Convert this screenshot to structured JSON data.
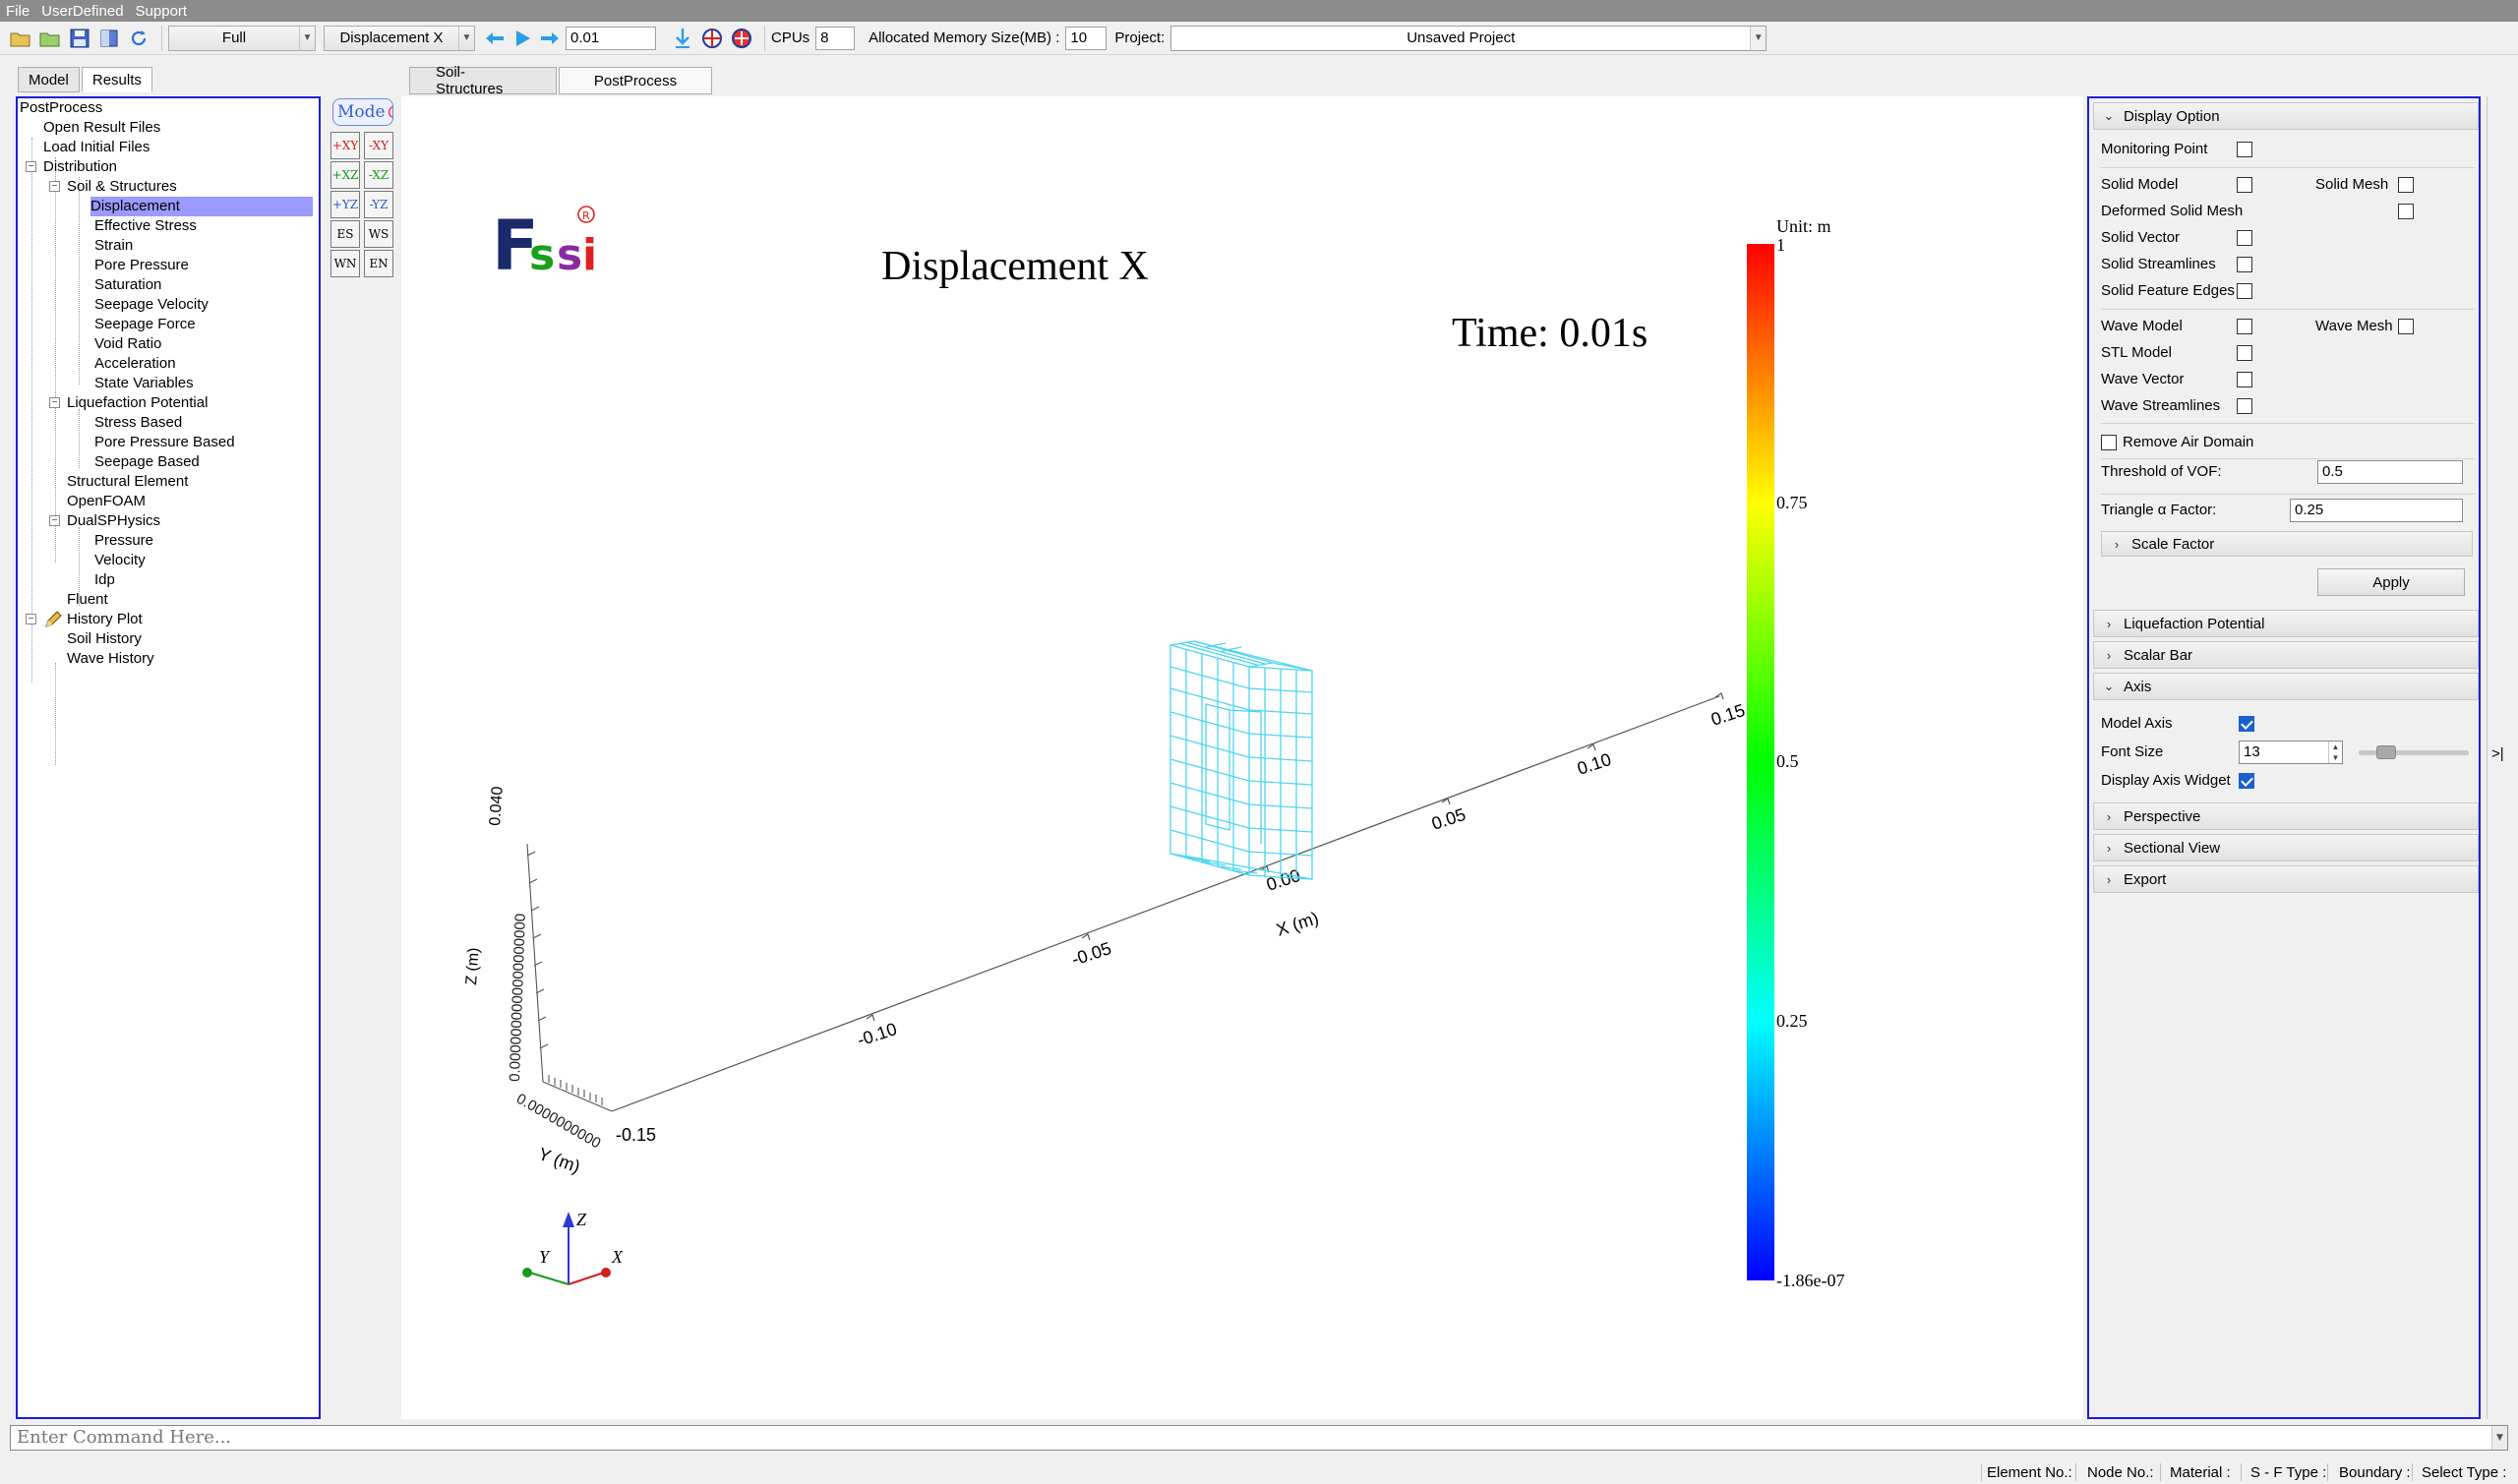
{
  "menu": [
    "File",
    "UserDefined",
    "Support"
  ],
  "toolbar": {
    "mode_combo": "Full",
    "result_combo": "Displacement X",
    "time_value": "0.01",
    "cpus_label": "CPUs",
    "cpus_value": "8",
    "memory_label": "Allocated Memory Size(MB) :",
    "memory_value": "10",
    "project_label": "Project:",
    "project_value": "Unsaved Project"
  },
  "left_tabs": [
    "Model",
    "Results"
  ],
  "tree": {
    "root": "PostProcess",
    "items": [
      "Open Result Files",
      "Load Initial Files",
      "Distribution",
      "Soil & Structures",
      "Displacement",
      "Effective Stress",
      "Strain",
      "Pore Pressure",
      "Saturation",
      "Seepage Velocity",
      "Seepage Force",
      "Void Ratio",
      "Acceleration",
      "State Variables",
      "Liquefaction Potential",
      "Stress Based",
      "Pore Pressure Based",
      "Seepage Based",
      "Structural Element",
      "OpenFOAM",
      "DualSPHysics",
      "Pressure",
      "Velocity",
      "Idp",
      "Fluent",
      "History Plot",
      "Soil History",
      "Wave History"
    ]
  },
  "view_tools": {
    "mode": "Mode",
    "buttons": [
      "+XY",
      "-XY",
      "+XZ",
      "-XZ",
      "+YZ",
      "-YZ",
      "ES",
      "WS",
      "WN",
      "EN"
    ]
  },
  "content_tabs": [
    "Soil-Structures",
    "PostProcess"
  ],
  "viewport": {
    "logo": "Fssi",
    "logo_mark": "R",
    "title": "Displacement X",
    "time_text": "Time: 0.01s",
    "unit_text": "Unit:   m",
    "colorbar_labels": [
      "1",
      "0.75",
      "0.5",
      "0.25",
      "-1.86e-07"
    ],
    "colorbar_colors": [
      "#ff0000",
      "#ffff00",
      "#00ff00",
      "#00ffff",
      "#0000ff"
    ],
    "x_axis_label": "X (m)",
    "x_ticks": [
      "-0.10",
      "-0.05",
      "0.00",
      "0.05",
      "0.10",
      "0.15"
    ],
    "y_axis_label": "Y (m)",
    "y_tick": "-0.15",
    "z_axis_label": "Z (m)",
    "z_tick_top": "0.040",
    "mesh_color": "#4dd6f0",
    "widget_labels": {
      "z": "Z",
      "y": "Y",
      "x": "X"
    }
  },
  "right_panel": {
    "display_option": "Display Option",
    "monitoring_point": "Monitoring Point",
    "solid_model": "Solid Model",
    "solid_mesh": "Solid Mesh",
    "deformed_solid_mesh": "Deformed Solid Mesh",
    "solid_vector": "Solid Vector",
    "solid_streamlines": "Solid Streamlines",
    "solid_feature_edges": "Solid Feature Edges",
    "wave_model": "Wave Model",
    "wave_mesh": "Wave Mesh",
    "stl_model": "STL Model",
    "wave_vector": "Wave Vector",
    "wave_streamlines": "Wave Streamlines",
    "remove_air_domain": "Remove Air Domain",
    "threshold_label": "Threshold of VOF:",
    "threshold_value": "0.5",
    "triangle_label": "Triangle α Factor:",
    "triangle_value": "0.25",
    "scale_factor": "Scale Factor",
    "apply": "Apply",
    "liquefaction_potential": "Liquefaction Potential",
    "scalar_bar": "Scalar Bar",
    "axis": "Axis",
    "model_axis": "Model Axis",
    "font_size_label": "Font Size",
    "font_size_value": "13",
    "display_axis_widget": "Display Axis Widget",
    "perspective": "Perspective",
    "sectional_view": "Sectional View",
    "export": "Export"
  },
  "command_placeholder": "Enter Command Here...",
  "status": {
    "element_no": "Element No.:",
    "node_no": "Node No.:",
    "material": "Material :",
    "sf_type": "S - F Type :",
    "boundary": "Boundary :",
    "select_type": "Select Type :"
  }
}
